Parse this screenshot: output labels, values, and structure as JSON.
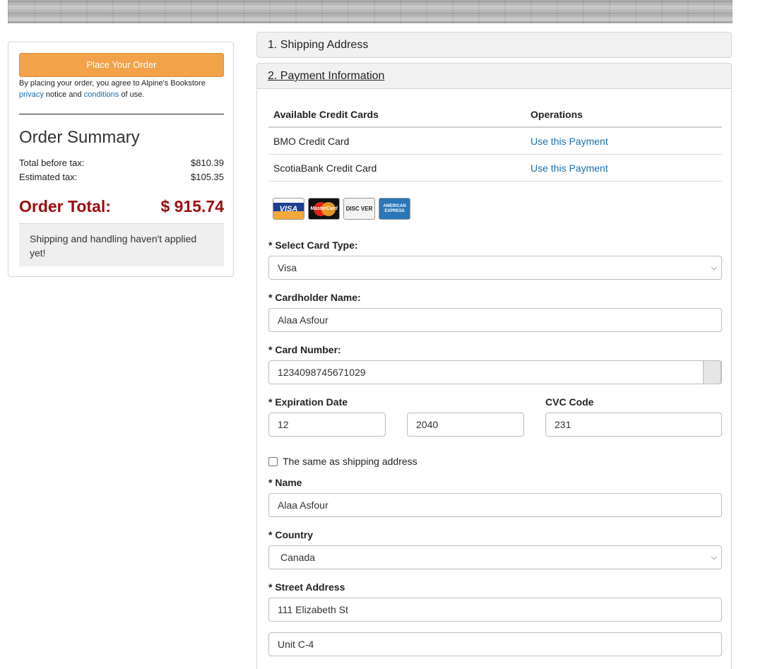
{
  "sidebar": {
    "place_order_label": "Place Your Order",
    "agree_prefix": "By placing your order, you agree to Alpine's Bookstore",
    "privacy_link": "privacy",
    "agree_middle": "notice and",
    "conditions_link": "conditions",
    "agree_suffix": "of use.",
    "summary_title": "Order Summary",
    "total_before_tax_label": "Total before tax:",
    "total_before_tax_value": "$810.39",
    "estimated_tax_label": "Estimated tax:",
    "estimated_tax_value": "$105.35",
    "order_total_label": "Order Total:",
    "order_total_value": "$ 915.74",
    "shipping_note": "Shipping and handling haven't applied yet!"
  },
  "panels": {
    "shipping_header": "1. Shipping Address",
    "payment_header": "2. Payment Information"
  },
  "credit_cards": {
    "headers": [
      "Available Credit Cards",
      "Operations"
    ],
    "rows": [
      {
        "name": "BMO Credit Card",
        "action": "Use this Payment"
      },
      {
        "name": "ScotiaBank Credit Card",
        "action": "Use this Payment"
      }
    ]
  },
  "card_logos": {
    "visa": "VISA",
    "mastercard": "MasterCard",
    "discover": "DISC VER",
    "amex": "AMERICAN EXPRESS"
  },
  "form": {
    "card_type_label": "* Select Card Type:",
    "card_type_value": "Visa",
    "cardholder_label": "* Cardholder Name:",
    "cardholder_value": "Alaa Asfour",
    "card_number_label": "* Card Number:",
    "card_number_value": "1234098745671029",
    "expiration_label": "* Expiration Date",
    "exp_month_value": "12",
    "exp_year_value": "2040",
    "cvc_label": "CVC Code",
    "cvc_value": "231",
    "same_as_shipping_label": "The same as shipping address",
    "same_as_shipping_checked": false,
    "name_label": "* Name",
    "name_value": "Alaa Asfour",
    "country_label": "* Country",
    "country_value": "Canada",
    "street_label": "* Street Address",
    "street_value": "111 Elizabeth St",
    "street2_value": "Unit C-4"
  },
  "colors": {
    "accent_orange": "#f3a24c",
    "total_red": "#9b0d0d",
    "link_blue": "#1a6fb0"
  }
}
